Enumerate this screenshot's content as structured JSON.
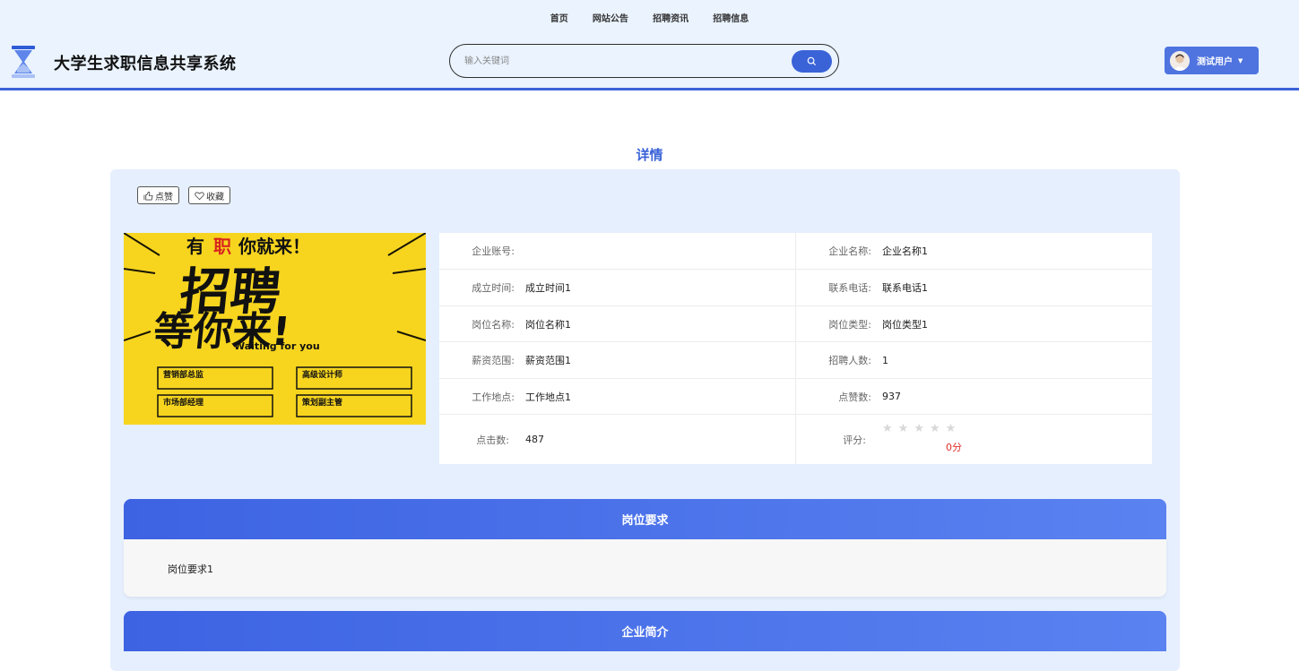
{
  "nav": {
    "items": [
      "首页",
      "网站公告",
      "招聘资讯",
      "招聘信息"
    ]
  },
  "site": {
    "title": "大学生求职信息共享系统"
  },
  "search": {
    "placeholder": "输入关键词"
  },
  "user": {
    "name": "测试用户"
  },
  "page": {
    "title": "详情"
  },
  "actions": {
    "like": "点赞",
    "favorite": "收藏"
  },
  "poster": {
    "line1a": "有",
    "line1b": "职",
    "line1c": "你就来！",
    "big1": "招聘",
    "big2": "等你来!",
    "sub": "Waiting for you",
    "items": [
      "营销部总监",
      "高级设计师",
      "市场部经理",
      "策划副主管"
    ]
  },
  "details": {
    "rows": [
      {
        "l_label": "企业账号:",
        "l_value": "",
        "r_label": "企业名称:",
        "r_value": "企业名称1"
      },
      {
        "l_label": "成立时间:",
        "l_value": "成立时间1",
        "r_label": "联系电话:",
        "r_value": "联系电话1"
      },
      {
        "l_label": "岗位名称:",
        "l_value": "岗位名称1",
        "r_label": "岗位类型:",
        "r_value": "岗位类型1"
      },
      {
        "l_label": "薪资范围:",
        "l_value": "薪资范围1",
        "r_label": "招聘人数:",
        "r_value": "1"
      },
      {
        "l_label": "工作地点:",
        "l_value": "工作地点1",
        "r_label": "点赞数:",
        "r_value": "937"
      }
    ],
    "clicks_label": "点击数:",
    "clicks_value": "487",
    "rating_label": "评分:",
    "rating_stars": 0,
    "rating_max": 5,
    "rating_text": "0分"
  },
  "sections": [
    {
      "title": "岗位要求",
      "content": "岗位要求1"
    },
    {
      "title": "企业简介",
      "content": ""
    }
  ],
  "colors": {
    "accent": "#3a63d8",
    "header_bg": "#eaf3fe",
    "card_bg": "#e6effd",
    "score_red": "#e0302b"
  }
}
